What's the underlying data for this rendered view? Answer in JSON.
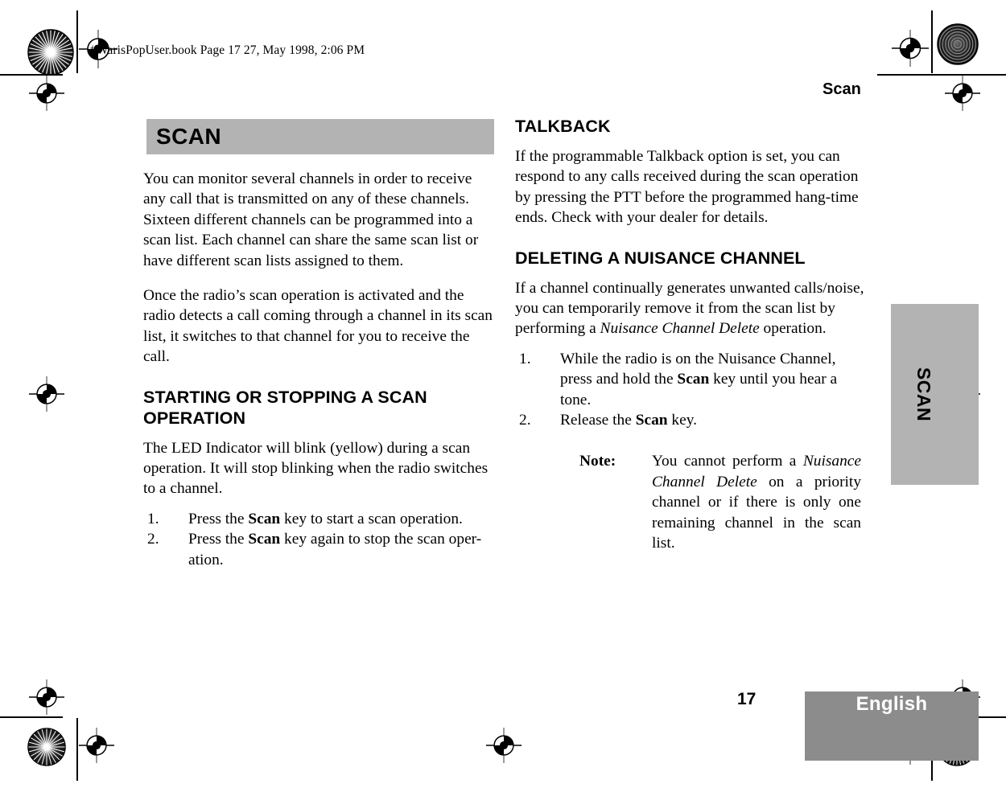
{
  "print_marks": {
    "file_stamp": "#WarisPopUser.book  Page 17  27, May 1998,   2:06 PM",
    "registration_icon": "registration-crosshair",
    "rosette_icon": "print-rosette"
  },
  "running_head": {
    "title": "Scan"
  },
  "left_column": {
    "banner_title": "SCAN",
    "paragraphs": [
      "You can monitor several channels in order to receive any call that is transmitted on any of these channels. Sixteen different channels can be programmed into a scan list. Each channel can share the same scan list or have different scan lists assigned to them.",
      "Once the radio’s scan operation is activated and the radio detects a call coming through a channel in its scan list, it switches to that channel for you to receive the call."
    ],
    "section_heading": "STARTING OR STOPPING A SCAN OPERATION",
    "section_intro": "The LED Indicator will blink (yellow) during a scan operation. It will stop blinking when the radio switches to a channel.",
    "steps": [
      {
        "num": "1.",
        "pre": "Press the ",
        "key": "Scan",
        "post": " key to start a scan operation."
      },
      {
        "num": "2.",
        "pre": "Press the ",
        "key": "Scan",
        "post": " key again to stop the scan oper-ation."
      }
    ]
  },
  "right_column": {
    "talkback": {
      "heading": "TALKBACK",
      "body": "If the programmable Talkback option is set, you can respond to any calls received during the scan operation by pressing the PTT before the programmed hang-time ends. Check with your dealer for details."
    },
    "nuisance": {
      "heading": "DELETING A NUISANCE CHANNEL",
      "body_pre": "If a channel continually generates unwanted calls/noise, you can temporarily remove it from the scan list by performing a ",
      "body_em": "Nuisance Channel Delete",
      "body_post": " operation.",
      "steps": [
        {
          "num": "1.",
          "pre": "While the radio is on the Nuisance Channel, press and hold the ",
          "key": "Scan",
          "post": " key until you hear a tone."
        },
        {
          "num": "2.",
          "pre": "Release the ",
          "key": "Scan",
          "post": " key."
        }
      ],
      "note": {
        "label": "Note:",
        "pre": "You cannot perform a ",
        "em": "Nuisance Channel Delete",
        "post": " on a priority channel or if there is only one remaining channel in the scan list."
      }
    }
  },
  "thumb_tab": {
    "label": "SCAN"
  },
  "footer": {
    "page_number": "17",
    "language": "English"
  },
  "colors": {
    "banner_gray": "#b3b3b3",
    "footer_gray": "#8c8c8c",
    "text": "#000000",
    "footer_text": "#ffffff"
  }
}
